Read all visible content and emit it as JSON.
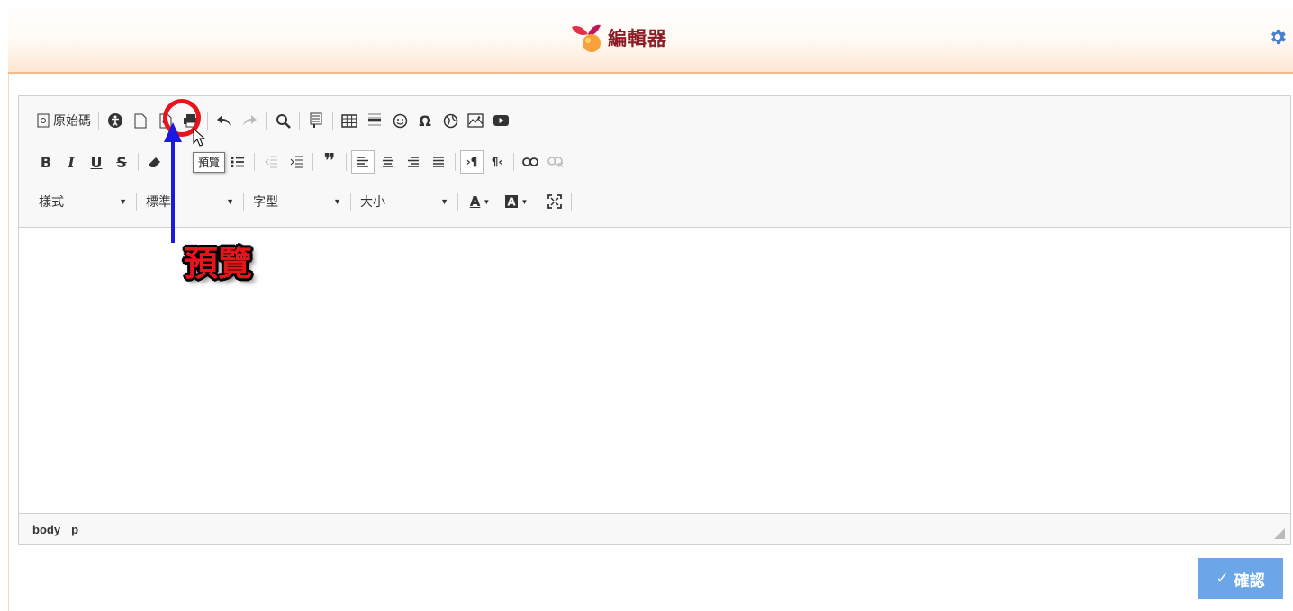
{
  "header": {
    "title": "編輯器",
    "icons": [
      "logo-icon",
      "gear-icon"
    ]
  },
  "toolbar": {
    "source_label": "原始碼",
    "styles_label": "樣式",
    "format_label": "標準",
    "font_label": "字型",
    "size_label": "大小",
    "preview_tooltip": "預覽"
  },
  "pathbar": {
    "items": [
      "body",
      "p"
    ]
  },
  "annotation": {
    "label": "預覽",
    "ring_color": "#e8141c",
    "arrow_color": "#1a1adc"
  },
  "confirm": {
    "label": "確認"
  },
  "colors": {
    "confirm_bg": "#6aa6e8",
    "header_gradient_bottom": "#fde6d2",
    "title": "#8a1c24"
  }
}
